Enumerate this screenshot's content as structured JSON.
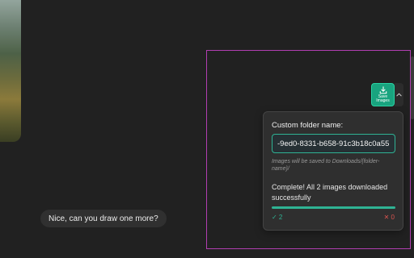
{
  "background": {
    "color": "#212121"
  },
  "save_button": {
    "label": "Save Images",
    "icon": "download-icon",
    "color": "#19a47f"
  },
  "dropdown_toggle": {
    "icon": "chevron-up-icon"
  },
  "panel": {
    "folder_label": "Custom folder name:",
    "folder_value": "-9ed0-8331-b658-91c3b18c0a55",
    "hint": "Images will be saved to Downloads/{folder-name}/",
    "status": "Complete! All 2 images downloaded successfully",
    "progress": 1.0,
    "success_count": "✓ 2",
    "error_count": "✕ 0",
    "accent_color": "#2fb394",
    "error_color": "#d9534f"
  },
  "chat": {
    "message": "Nice, can you draw one more?"
  },
  "selection_border_color": "#b13eb1"
}
